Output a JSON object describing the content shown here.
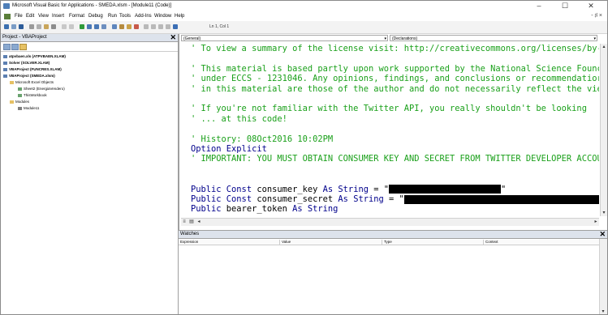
{
  "window": {
    "title": "Microsoft Visual Basic for Applications - SMEDA.xlsm - [Module11 (Code)]",
    "controls": [
      "–",
      "☐",
      "✕"
    ]
  },
  "menu": {
    "items": [
      "File",
      "Edit",
      "View",
      "Insert",
      "Format",
      "Debug",
      "Run",
      "Tools",
      "Add-Ins",
      "Window",
      "Help"
    ],
    "mdi_controls": "- ♯ ×"
  },
  "toolbar": {
    "position": "Ln 1, Col 1"
  },
  "project": {
    "title": "Project - VBAProject",
    "tree": [
      {
        "label": "atpvbaen.xls (ATPVBAEN.XLAM)",
        "bold": true
      },
      {
        "label": "Solver (SOLVER.XLAM)",
        "bold": true
      },
      {
        "label": "VBAProject (FUNCRES.XLAM)",
        "bold": true
      },
      {
        "label": "VBAProject (SMEDA.xlsm)",
        "bold": true
      },
      {
        "label": "Microsoft Excel Objects",
        "bold": false
      },
      {
        "label": "Sheet2 (EnergiaVendero)",
        "bold": false
      },
      {
        "label": "ThisWorkbook",
        "bold": false
      },
      {
        "label": "Modules",
        "bold": false
      },
      {
        "label": "Module11",
        "bold": false
      }
    ]
  },
  "code_window": {
    "object_combo": "(General)",
    "proc_combo": "(Declarations)",
    "lines": [
      {
        "t": "comment",
        "text": "' To view a summary of the license visit: http://creativecommons.org/licenses/by-"
      },
      {
        "t": "blank",
        "text": ""
      },
      {
        "t": "comment",
        "text": "' This material is based partly upon work supported by the National Science Founc"
      },
      {
        "t": "comment",
        "text": "' under ECCS - 1231046. Any opinions, findings, and conclusions or recommendatior"
      },
      {
        "t": "comment",
        "text": "' in this material are those of the author and do not necessarily reflect the vie"
      },
      {
        "t": "blank",
        "text": ""
      },
      {
        "t": "comment",
        "text": "' If you're not familiar with the Twitter API, you really shouldn't be looking"
      },
      {
        "t": "comment",
        "text": "' ... at this code!"
      },
      {
        "t": "blank",
        "text": ""
      },
      {
        "t": "comment",
        "text": "' History: 08Oct2016 10:02PM"
      },
      {
        "t": "keyword",
        "text": "Option Explicit"
      },
      {
        "t": "comment",
        "text": "' IMPORTANT: YOU MUST OBTAIN CONSUMER KEY AND SECRET FROM TWITTER DEVELOPER ACCOU"
      }
    ],
    "decl1": {
      "kw1": "Public Const ",
      "name": "consumer_key ",
      "kw2": "As String",
      "rest": " = \"",
      "tail": "\""
    },
    "decl2": {
      "kw1": "Public Const ",
      "name": "consumer_secret ",
      "kw2": "As String",
      "rest": " = \""
    },
    "decl3": {
      "kw1": "Public ",
      "name": "bearer_token ",
      "kw2": "As String"
    }
  },
  "watches": {
    "title": "Watches",
    "columns": [
      "Expression",
      "Value",
      "Type",
      "Context"
    ]
  },
  "colors": {
    "comment": "#1aa01a",
    "keyword": "#00008b",
    "panel_title": "#dde3ec"
  }
}
